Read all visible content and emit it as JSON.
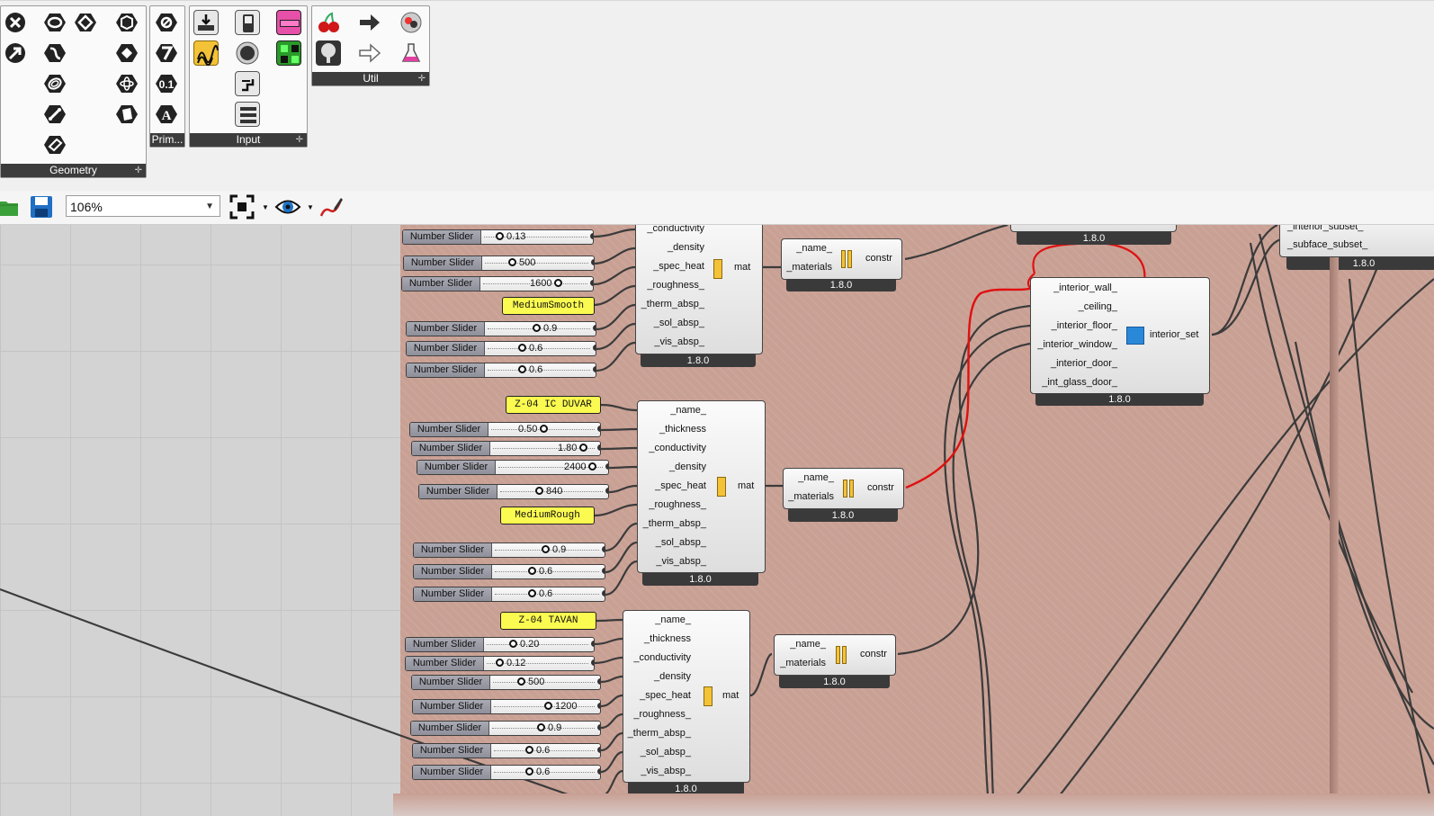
{
  "ribbon": {
    "panels": [
      {
        "id": "geometry",
        "label": "Geometry"
      },
      {
        "id": "primitive",
        "label": "Prim..."
      },
      {
        "id": "input",
        "label": "Input"
      },
      {
        "id": "util",
        "label": "Util"
      }
    ]
  },
  "toolbar": {
    "zoom_level": "106%"
  },
  "canvas": {
    "sliders": [
      {
        "label": "Number Slider",
        "value": "0.13"
      },
      {
        "label": "Number Slider",
        "value": "500"
      },
      {
        "label": "Number Slider",
        "value": "1600"
      },
      {
        "label": "Number Slider",
        "value": "0.9"
      },
      {
        "label": "Number Slider",
        "value": "0.6"
      },
      {
        "label": "Number Slider",
        "value": "0.6"
      },
      {
        "label": "Number Slider",
        "value": "0.50"
      },
      {
        "label": "Number Slider",
        "value": "1.80"
      },
      {
        "label": "Number Slider",
        "value": "2400"
      },
      {
        "label": "Number Slider",
        "value": "840"
      },
      {
        "label": "Number Slider",
        "value": "0.9"
      },
      {
        "label": "Number Slider",
        "value": "0.6"
      },
      {
        "label": "Number Slider",
        "value": "0.6"
      },
      {
        "label": "Number Slider",
        "value": "0.20"
      },
      {
        "label": "Number Slider",
        "value": "0.12"
      },
      {
        "label": "Number Slider",
        "value": "500"
      },
      {
        "label": "Number Slider",
        "value": "1200"
      },
      {
        "label": "Number Slider",
        "value": "0.9"
      },
      {
        "label": "Number Slider",
        "value": "0.6"
      },
      {
        "label": "Number Slider",
        "value": "0.6"
      }
    ],
    "panels": [
      "MediumSmooth",
      "Z-04 IC DUVAR",
      "MediumRough",
      "Z-04 TAVAN"
    ],
    "mat_inputs": [
      "_name_",
      "_thickness",
      "_conductivity",
      "_density",
      "_spec_heat",
      "_roughness_",
      "_therm_absp_",
      "_sol_absp_",
      "_vis_absp_"
    ],
    "mat_output": "mat",
    "constr_inputs": [
      "_name_",
      "_materials"
    ],
    "constr_output": "constr",
    "set_inputs": [
      "_interior_wall_",
      "_ceiling_",
      "_interior_floor_",
      "_interior_window_",
      "_interior_door_",
      "_int_glass_door_"
    ],
    "set_output": "interior_set",
    "subset_inputs": [
      "_interior_subset_",
      "_subface_subset_"
    ],
    "version": "1.8.0"
  }
}
